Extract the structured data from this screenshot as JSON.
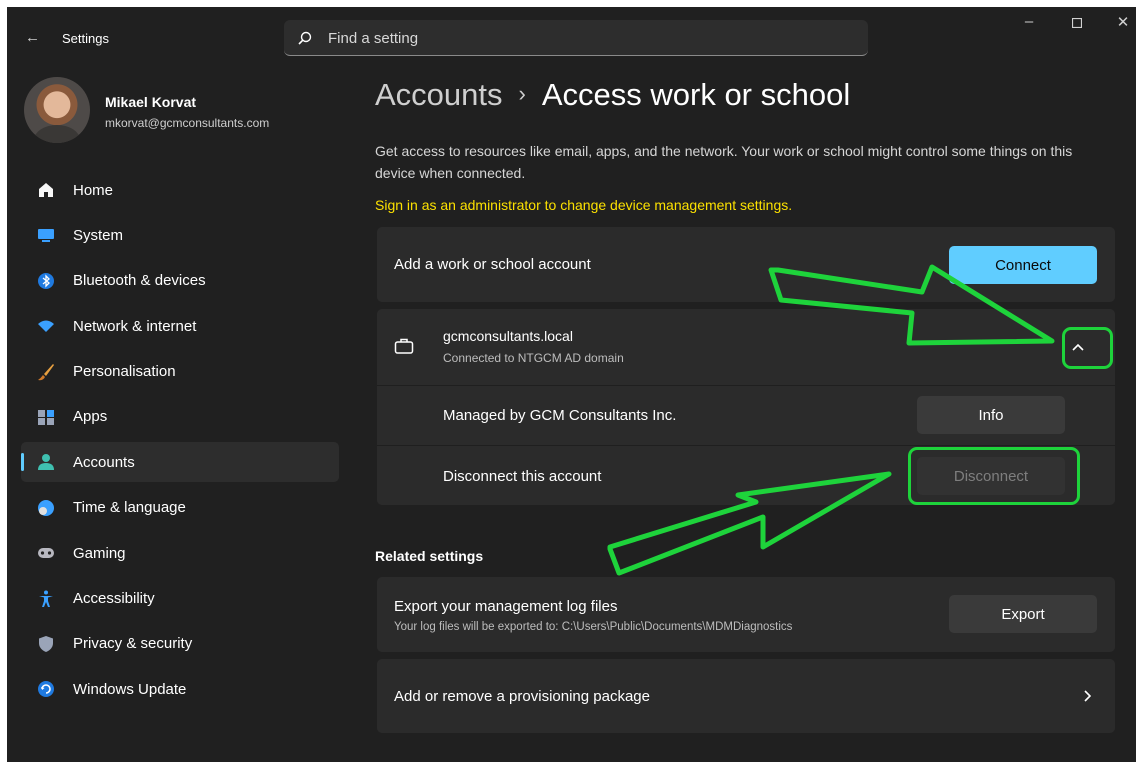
{
  "window": {
    "title": "Settings",
    "controls": [
      "minimize-icon",
      "maximize-icon",
      "close-icon"
    ]
  },
  "search": {
    "placeholder": "Find a setting"
  },
  "user": {
    "name": "Mikael Korvat",
    "email": "mkorvat@gcmconsultants.com"
  },
  "sidebar": {
    "items": [
      {
        "label": "Home",
        "icon": "home-icon",
        "active": false
      },
      {
        "label": "System",
        "icon": "system-icon",
        "active": false
      },
      {
        "label": "Bluetooth & devices",
        "icon": "bluetooth-icon",
        "active": false
      },
      {
        "label": "Network & internet",
        "icon": "network-icon",
        "active": false
      },
      {
        "label": "Personalisation",
        "icon": "brush-icon",
        "active": false
      },
      {
        "label": "Apps",
        "icon": "apps-icon",
        "active": false
      },
      {
        "label": "Accounts",
        "icon": "accounts-icon",
        "active": true
      },
      {
        "label": "Time & language",
        "icon": "globe-icon",
        "active": false
      },
      {
        "label": "Gaming",
        "icon": "gamepad-icon",
        "active": false
      },
      {
        "label": "Accessibility",
        "icon": "accessibility-icon",
        "active": false
      },
      {
        "label": "Privacy & security",
        "icon": "shield-icon",
        "active": false
      },
      {
        "label": "Windows Update",
        "icon": "update-icon",
        "active": false
      }
    ]
  },
  "main": {
    "breadcrumb_parent": "Accounts",
    "breadcrumb_separator": "›",
    "breadcrumb_current": "Access work or school",
    "description": "Get access to resources like email, apps, and the network. Your work or school might control some things on this device when connected.",
    "admin_note": "Sign in as an administrator to change device management settings.",
    "add_account": {
      "label": "Add a work or school account",
      "button": "Connect"
    },
    "account": {
      "name": "gcmconsultants.local",
      "status": "Connected to NTGCM AD domain",
      "expanded": true,
      "managed_label": "Managed by GCM Consultants Inc.",
      "info_button": "Info",
      "disconnect_label": "Disconnect this account",
      "disconnect_button": "Disconnect",
      "disconnect_enabled": false
    },
    "related_heading": "Related settings",
    "export_logs": {
      "title": "Export your management log files",
      "subtitle": "Your log files will be exported to: C:\\Users\\Public\\Documents\\MDMDiagnostics",
      "button": "Export"
    },
    "provisioning": {
      "label": "Add or remove a provisioning package"
    }
  },
  "colors": {
    "background": "#202020",
    "card": "#2b2b2b",
    "accent": "#60cdff",
    "warning_text": "#fce100",
    "annotation": "#1ed33b"
  }
}
